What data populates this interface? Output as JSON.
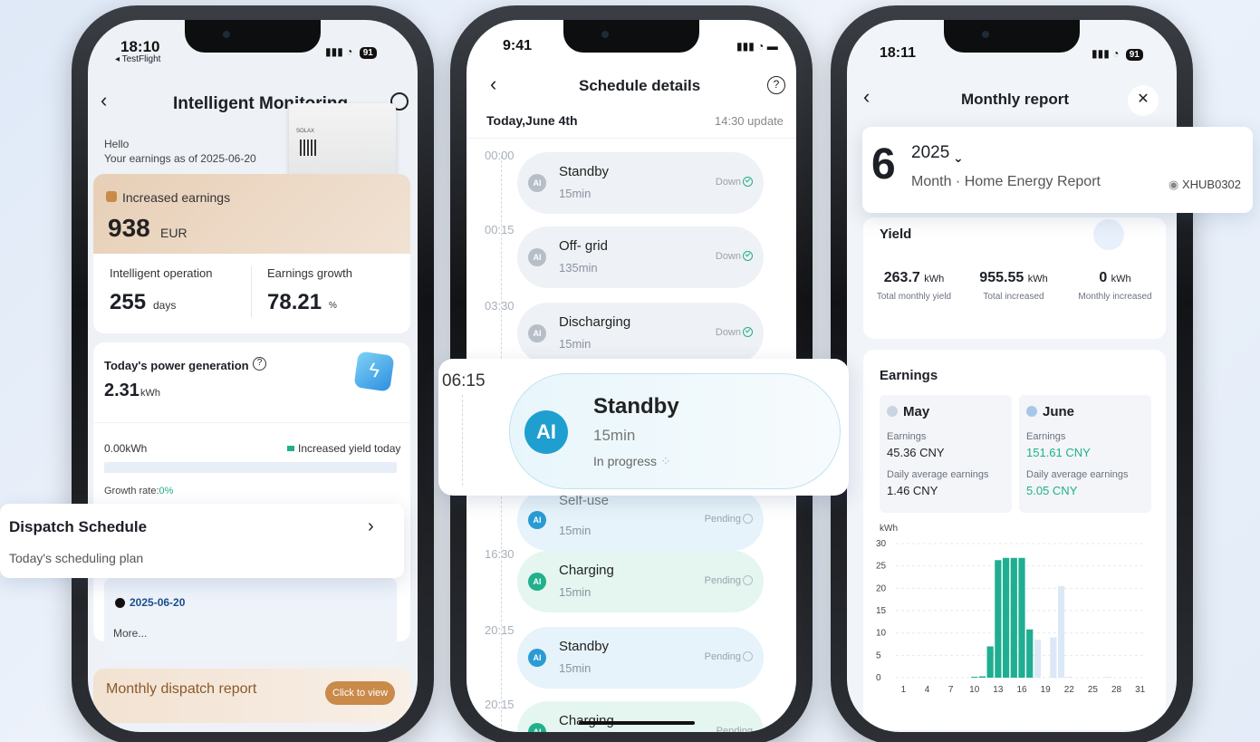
{
  "colors": {
    "accent": "#20b08c",
    "blue": "#2a9bd4",
    "brand_tan": "#e8d3be",
    "teal_bar": "#1fae91",
    "light_bar": "#dbe8f6"
  },
  "phone1": {
    "status_time": "18:10",
    "status_back": "◂ TestFlight",
    "battery": "91",
    "title": "Intelligent Monitoring",
    "hello": "Hello",
    "earnings_asof": "Your earnings as of 2025-06-20",
    "increased_label": "Increased earnings",
    "increased_value": "938",
    "increased_unit": "EUR",
    "op_label": "Intelligent operation",
    "op_value": "255",
    "op_unit": "days",
    "growth_label": "Earnings growth",
    "growth_value": "78.21",
    "growth_unit": "%",
    "today_label": "Today's power generation",
    "today_value": "2.31",
    "today_unit": "kWh",
    "kwh_left": "0.00kWh",
    "legend_yield": "Increased yield today",
    "growth_rate_label": "Growth rate:",
    "growth_rate_value": "0%",
    "schedule_date": "2025-06-20",
    "more": "More...",
    "monthly_report": "Monthly dispatch report",
    "click_view": "Click to view"
  },
  "dispatch_overlay": {
    "title": "Dispatch Schedule",
    "subtitle": "Today's scheduling plan"
  },
  "phone2": {
    "status_time": "9:41",
    "title": "Schedule details",
    "date": "Today,June 4th",
    "update": "14:30 update",
    "items": [
      {
        "time": "00:00",
        "title": "Standby",
        "sub": "15min",
        "state": "Down"
      },
      {
        "time": "00:15",
        "title": "Off- grid",
        "sub": "135min",
        "state": "Down"
      },
      {
        "time": "03:30",
        "title": "Discharging",
        "sub": "15min",
        "state": "Down"
      },
      {
        "time": "",
        "title": "Self-use",
        "sub": "15min",
        "state": "Pending"
      },
      {
        "time": "16:30",
        "title": "Charging",
        "sub": "15min",
        "state": "Pending"
      },
      {
        "time": "20:15",
        "title": "Standby",
        "sub": "15min",
        "state": "Pending"
      },
      {
        "time": "20:15",
        "title": "Charging",
        "sub": "",
        "state": "Pending"
      }
    ]
  },
  "current_overlay": {
    "time": "06:15",
    "ai": "AI",
    "title": "Standby",
    "sub": "15min",
    "status": "In progress"
  },
  "ai_label": "AI",
  "phone3": {
    "status_time": "18:11",
    "battery": "91",
    "title": "Monthly report",
    "yield_label": "Yield",
    "stats": [
      {
        "value": "263.7",
        "unit": "kWh",
        "label": "Total monthly yield"
      },
      {
        "value": "955.55",
        "unit": "kWh",
        "label": "Total increased"
      },
      {
        "value": "0",
        "unit": "kWh",
        "label": "Monthly increased"
      }
    ],
    "earnings_label": "Earnings",
    "months": [
      {
        "name": "May",
        "earn_label": "Earnings",
        "earn": "45.36 CNY",
        "avg_label": "Daily average earnings",
        "avg": "1.46 CNY"
      },
      {
        "name": "June",
        "earn_label": "Earnings",
        "earn": "151.61 CNY",
        "avg_label": "Daily average earnings",
        "avg": "5.05 CNY"
      }
    ]
  },
  "report_overlay": {
    "month_num": "6",
    "year": "2025",
    "subtitle": "Month · Home Energy Report",
    "device": "XHUB0302"
  },
  "chart_data": {
    "type": "bar",
    "ylabel": "kWh",
    "ylim": [
      0,
      30
    ],
    "y_ticks": [
      "30",
      "25",
      "20",
      "15",
      "10",
      "5",
      "0"
    ],
    "x_ticks": [
      "1",
      "4",
      "7",
      "10",
      "13",
      "16",
      "19",
      "22",
      "25",
      "28",
      "31"
    ],
    "x": [
      1,
      2,
      3,
      4,
      5,
      6,
      7,
      8,
      9,
      10,
      11,
      12,
      13,
      14,
      15,
      16,
      17,
      18,
      19,
      20,
      21,
      22,
      23,
      24,
      25,
      26,
      27,
      28,
      29,
      30,
      31
    ],
    "series": [
      {
        "color": "#1fae91",
        "values": [
          0,
          0,
          0,
          0,
          0,
          0,
          0,
          0,
          0,
          0.2,
          0.3,
          7,
          26.3,
          26.8,
          26.8,
          26.8,
          10.8,
          0,
          0,
          0,
          0,
          0,
          0,
          0,
          0,
          0,
          0,
          0,
          0,
          0,
          0
        ]
      },
      {
        "color": "#dbe8f6",
        "values": [
          0,
          0,
          0,
          0,
          0,
          0,
          0,
          0,
          0,
          0,
          0,
          0,
          0,
          0,
          0,
          0,
          0,
          8.5,
          0,
          9,
          20.5,
          0.2,
          0,
          0,
          0,
          0,
          0.2,
          0,
          0,
          0,
          0
        ]
      }
    ]
  }
}
